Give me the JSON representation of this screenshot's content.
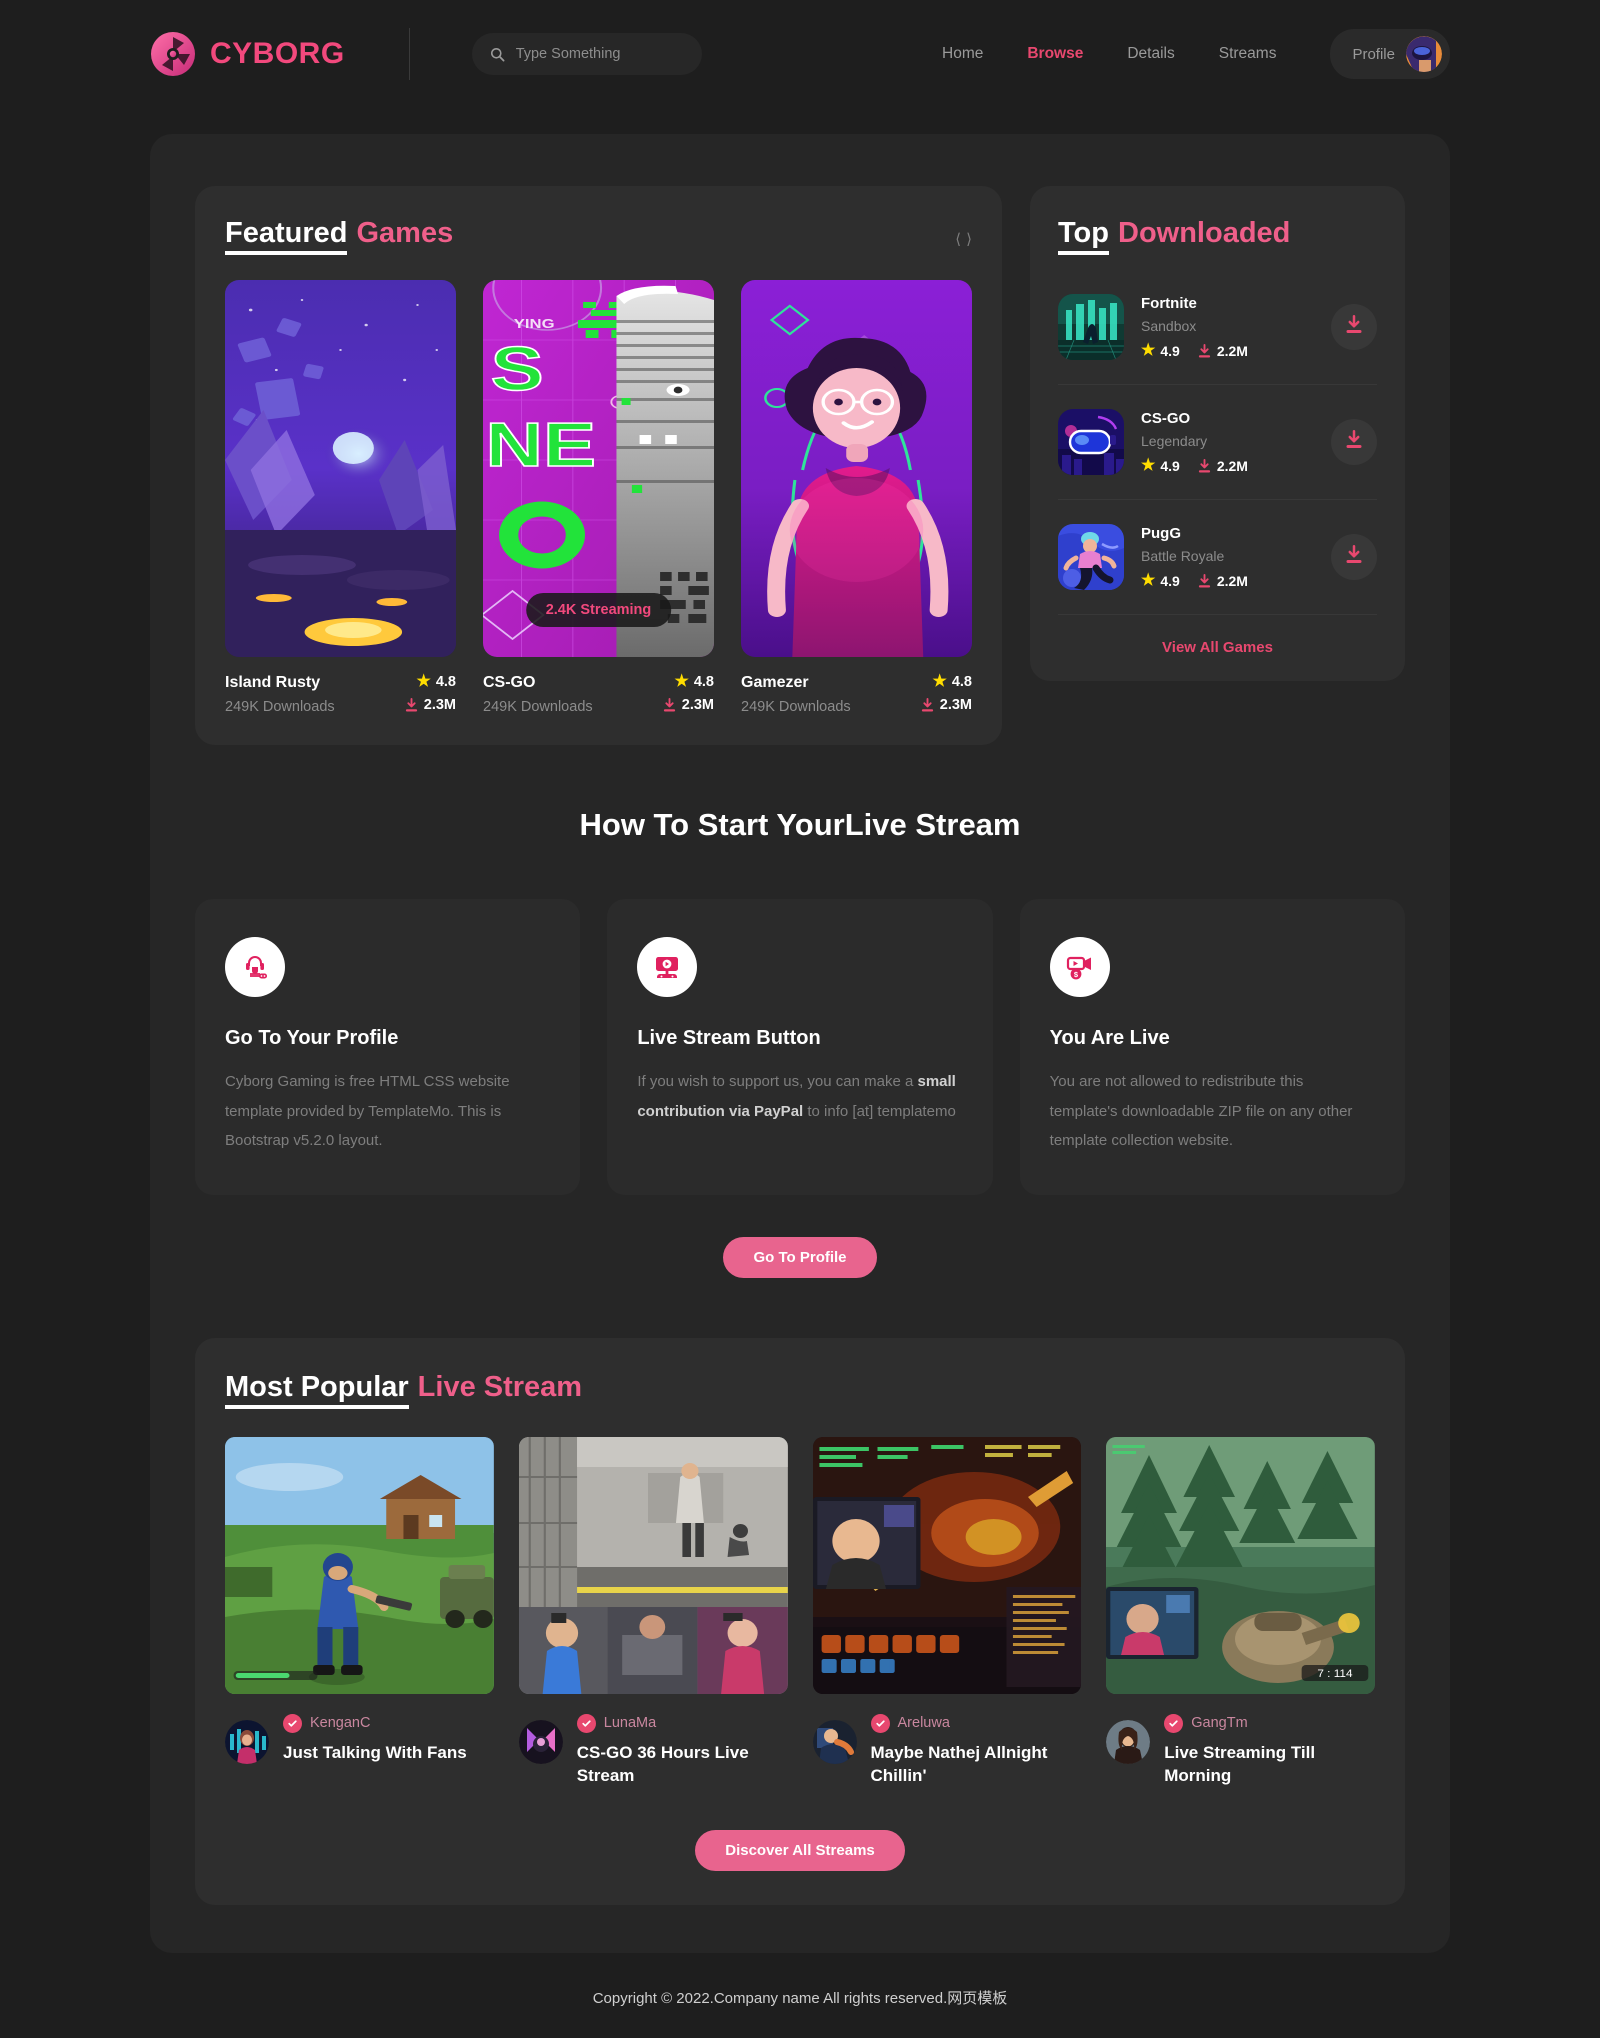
{
  "brand": {
    "name": "CYBORG",
    "logo_icon": "cyborg-aperture-logo",
    "accent": "#f2497d"
  },
  "search": {
    "placeholder": "Type Something",
    "value": "",
    "icon": "search-icon"
  },
  "nav": {
    "items": [
      {
        "label": "Home",
        "active": false
      },
      {
        "label": "Browse",
        "active": true
      },
      {
        "label": "Details",
        "active": false
      },
      {
        "label": "Streams",
        "active": false
      }
    ],
    "profile_label": "Profile",
    "avatar_icon": "user-avatar"
  },
  "featured": {
    "title_white": "Featured",
    "title_pink": "Games",
    "prev_icon": "chevron-left-icon",
    "next_icon": "chevron-right-icon",
    "games": [
      {
        "name": "Island Rusty",
        "downloads_label": "249K Downloads",
        "rating": "4.8",
        "downloads": "2.3M",
        "badge": ""
      },
      {
        "name": "CS-GO",
        "downloads_label": "249K Downloads",
        "rating": "4.8",
        "downloads": "2.3M",
        "badge": "2.4K Streaming"
      },
      {
        "name": "Gamezer",
        "downloads_label": "249K Downloads",
        "rating": "4.8",
        "downloads": "2.3M",
        "badge": ""
      }
    ]
  },
  "top_downloaded": {
    "title_white": "Top",
    "title_pink": "Downloaded",
    "items": [
      {
        "name": "Fortnite",
        "category": "Sandbox",
        "rating": "4.9",
        "downloads": "2.2M",
        "download_icon": "download-icon"
      },
      {
        "name": "CS-GO",
        "category": "Legendary",
        "rating": "4.9",
        "downloads": "2.2M",
        "download_icon": "download-icon"
      },
      {
        "name": "PugG",
        "category": "Battle Royale",
        "rating": "4.9",
        "downloads": "2.2M",
        "download_icon": "download-icon"
      }
    ],
    "view_all_label": "View All Games"
  },
  "howto": {
    "title_white": "How To Start Your",
    "title_pink": "Live Stream",
    "cards": [
      {
        "icon": "gamer-headset-icon",
        "heading": "Go To Your Profile",
        "text_before": "Cyborg Gaming is free HTML CSS website template provided by TemplateMo. This is Bootstrap v5.2.0 layout.",
        "text_strong": "",
        "text_after": ""
      },
      {
        "icon": "stream-monitor-icon",
        "heading": "Live Stream Button",
        "text_before": "If you wish to support us, you can make a ",
        "text_strong": "small contribution via PayPal",
        "text_after": " to info [at] templatemo"
      },
      {
        "icon": "video-money-icon",
        "heading": "You Are Live",
        "text_before": "You are not allowed to redistribute this template's downloadable ZIP file on any other template collection website.",
        "text_strong": "",
        "text_after": ""
      }
    ],
    "cta_label": "Go To Profile"
  },
  "popular": {
    "title_white": "Most Popular",
    "title_pink": "Live Stream",
    "streams": [
      {
        "user": "KenganC",
        "title": "Just Talking With Fans",
        "verified_icon": "verified-check-icon",
        "avatar_icon": "streamer-avatar"
      },
      {
        "user": "LunaMa",
        "title": "CS-GO 36 Hours Live Stream",
        "verified_icon": "verified-check-icon",
        "avatar_icon": "streamer-avatar"
      },
      {
        "user": "Areluwa",
        "title": "Maybe Nathej Allnight Chillin'",
        "verified_icon": "verified-check-icon",
        "avatar_icon": "streamer-avatar"
      },
      {
        "user": "GangTm",
        "title": "Live Streaming Till Morning",
        "verified_icon": "verified-check-icon",
        "avatar_icon": "streamer-avatar"
      }
    ],
    "cta_label": "Discover All Streams"
  },
  "footer": {
    "copyright": "Copyright © 2022.Company name All rights reserved.网页模板"
  }
}
